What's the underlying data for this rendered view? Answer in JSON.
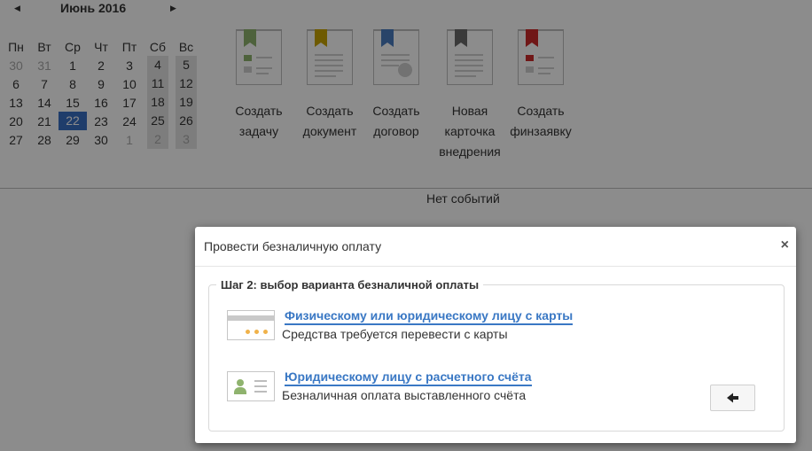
{
  "calendar": {
    "prev_icon": "triangle-left-icon",
    "next_icon": "triangle-right-icon",
    "title": "Июнь 2016",
    "weekdays": [
      "Пн",
      "Вт",
      "Ср",
      "Чт",
      "Пт",
      "Сб",
      "Вс"
    ],
    "weeks": [
      [
        "30",
        "31",
        "1",
        "2",
        "3",
        "4",
        "5"
      ],
      [
        "6",
        "7",
        "8",
        "9",
        "10",
        "11",
        "12"
      ],
      [
        "13",
        "14",
        "15",
        "16",
        "17",
        "18",
        "19"
      ],
      [
        "20",
        "21",
        "22",
        "23",
        "24",
        "25",
        "26"
      ],
      [
        "27",
        "28",
        "29",
        "30",
        "1",
        "2",
        "3"
      ]
    ],
    "today": "22",
    "accent": "#3a6fc4"
  },
  "actions": [
    {
      "label_lines": [
        "Создать",
        "задачу"
      ],
      "icon": "task-doc-icon",
      "color": "#8fb36e"
    },
    {
      "label_lines": [
        "Создать",
        "документ"
      ],
      "icon": "document-icon",
      "color": "#c9a400"
    },
    {
      "label_lines": [
        "Создать",
        "договор"
      ],
      "icon": "contract-doc-icon",
      "color": "#4a7cc0"
    },
    {
      "label_lines": [
        "Новая",
        "карточка",
        "внедрения"
      ],
      "icon": "card-doc-icon",
      "color": "#6a6a6a"
    },
    {
      "label_lines": [
        "Создать",
        "финзаявку"
      ],
      "icon": "finance-doc-icon",
      "color": "#cc2a2a"
    }
  ],
  "events": {
    "empty_text": "Нет событий"
  },
  "modal": {
    "title": "Провести безналичную оплату",
    "close_label": "×",
    "step_title": "Шаг 2: выбор варианта безналичной оплаты",
    "options": [
      {
        "link": "Физическому или юридическому лицу с карты",
        "desc": "Средства требуется перевести с карты",
        "icon": "bank-card-icon"
      },
      {
        "link": "Юридическому лицу с расчетного счёта",
        "desc": "Безналичная оплата выставленного счёта",
        "icon": "account-card-icon"
      }
    ],
    "back_icon": "arrow-left-icon"
  }
}
